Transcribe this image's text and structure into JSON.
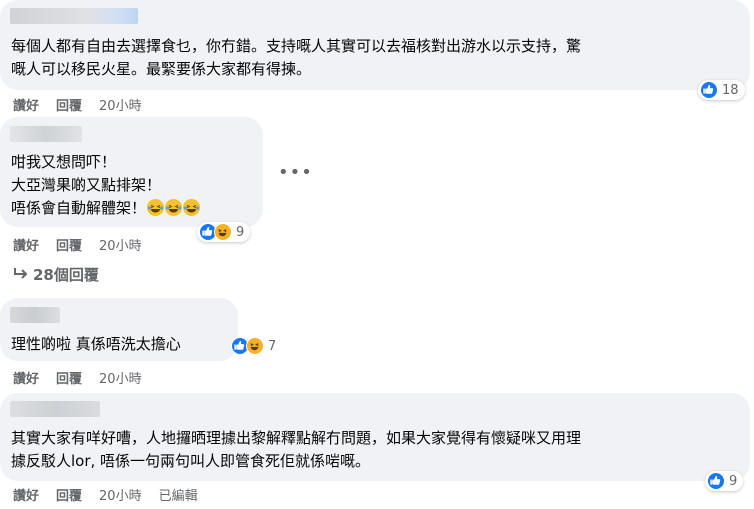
{
  "actions": {
    "like": "讚好",
    "reply": "回覆",
    "edited": "已編輯"
  },
  "comments": [
    {
      "text": "每個人都有自由去選擇食乜，你冇錯。支持嘅人其實可以去福核對出游水以示支持，驚\n嘅人可以移民火星。最緊要係大家都有得揀。",
      "time": "20小時",
      "reaction_count": "18",
      "reaction_icons": [
        "like-icon"
      ]
    },
    {
      "text": "咁我又想問吓！\n大亞灣果啲又點排架！\n唔係會自動解體架！",
      "emojis": [
        "laugh-cry-emoji",
        "laugh-cry-emoji",
        "laugh-cry-emoji"
      ],
      "time": "20小時",
      "reaction_count": "9",
      "reaction_icons": [
        "like-icon",
        "haha-icon"
      ],
      "replies_label": "28個回覆"
    },
    {
      "text": "理性啲啦 真係唔洗太擔心",
      "time": "20小時",
      "reaction_count": "7",
      "reaction_icons": [
        "like-icon",
        "haha-icon"
      ]
    },
    {
      "text": "其實大家有咩好嘈，人地攞晒理據出黎解釋點解冇問題，如果大家覺得有懷疑咪又用理\n據反駁人lor, 唔係一句兩句叫人即管食死佢就係啱嘅。",
      "time": "20小時",
      "reaction_count": "9",
      "reaction_icons": [
        "like-icon"
      ],
      "edited": true
    }
  ],
  "colors": {
    "bubble": "#f0f2f5",
    "like_blue": "#1877f2",
    "haha_yellow": "#f7b125",
    "meta_gray": "#65676b"
  }
}
